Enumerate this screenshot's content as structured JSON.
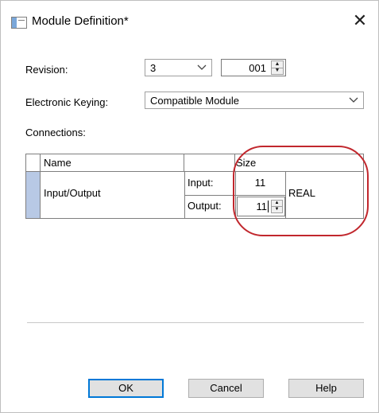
{
  "window": {
    "title": "Module Definition*",
    "close_label": "✕"
  },
  "revision": {
    "label": "Revision:",
    "major_value": "3",
    "minor_value": "001"
  },
  "keying": {
    "label": "Electronic Keying:",
    "value": "Compatible Module"
  },
  "connections": {
    "label": "Connections:",
    "headers": {
      "name": "Name",
      "type": "",
      "size": "Size"
    },
    "row": {
      "name": "Input/Output",
      "input_label": "Input:",
      "input_value": "11",
      "output_label": "Output:",
      "output_value": "11",
      "data_type": "REAL"
    }
  },
  "buttons": {
    "ok": "OK",
    "cancel": "Cancel",
    "help": "Help"
  },
  "icons": {
    "chevron": "chevron-down-icon",
    "spin": "spin-arrows-icon",
    "close": "close-icon",
    "window": "module-window-icon"
  },
  "colors": {
    "accent": "#0078d7",
    "row_selector": "#b8c9e5",
    "annotation_ring": "#c1272d"
  }
}
